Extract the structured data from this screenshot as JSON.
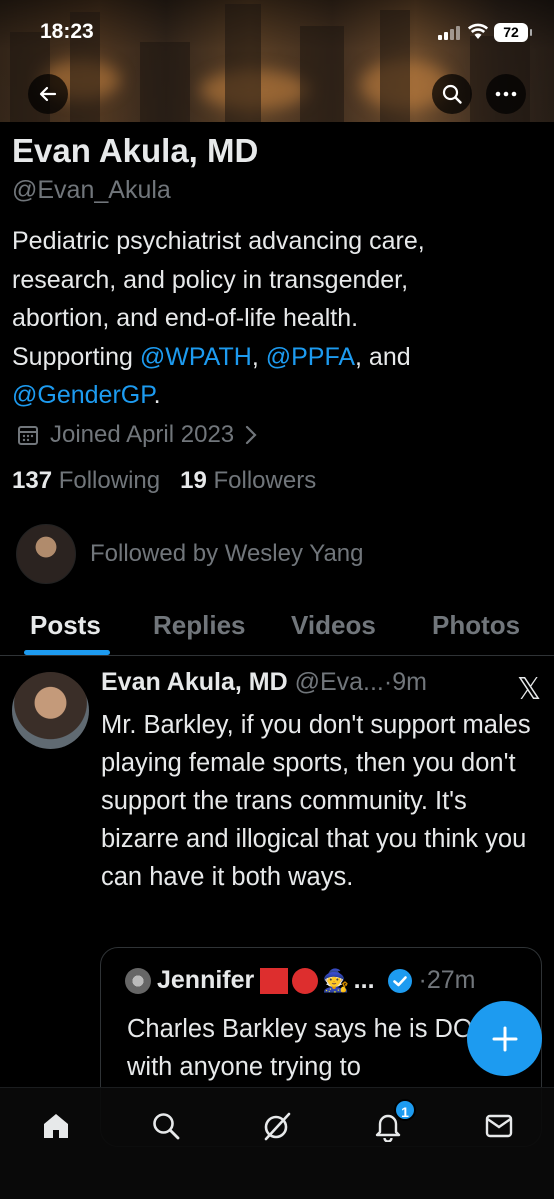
{
  "status_bar": {
    "time": "18:23",
    "battery": "72"
  },
  "profile": {
    "name": "Evan Akula, MD",
    "handle": "@Evan_Akula",
    "bio": {
      "line1": "Pediatric psychiatrist advancing care,",
      "line2": "research, and policy in transgender,",
      "line3": "abortion, and end-of-life health.",
      "line4_prefix": "Supporting ",
      "mention1": "@WPATH",
      "sep1": ", ",
      "mention2": "@PPFA",
      "sep2": ", and",
      "mention3": "@GenderGP",
      "end": "."
    },
    "joined": "Joined April 2023",
    "following_count": "137",
    "following_label": "Following",
    "followers_count": "19",
    "followers_label": "Followers",
    "followed_by": "Followed by Wesley Yang"
  },
  "tabs": [
    "Posts",
    "Replies",
    "Videos",
    "Photos"
  ],
  "post": {
    "author": "Evan Akula, MD",
    "handle": "@Eva...",
    "time": "·9m",
    "text": "Mr. Barkley, if you don't support males playing female sports, then you don't support the trans community. It's bizarre and illogical that you think you can have it both ways."
  },
  "quote": {
    "author": "Jennifer",
    "dots": "...",
    "time": "·27m",
    "text": "Charles Barkley says he is DONE with anyone trying to"
  },
  "nav": {
    "notifications_badge": "1"
  },
  "colors": {
    "accent": "#1d9bf0",
    "muted": "#71767b",
    "text": "#e7e9ea"
  }
}
